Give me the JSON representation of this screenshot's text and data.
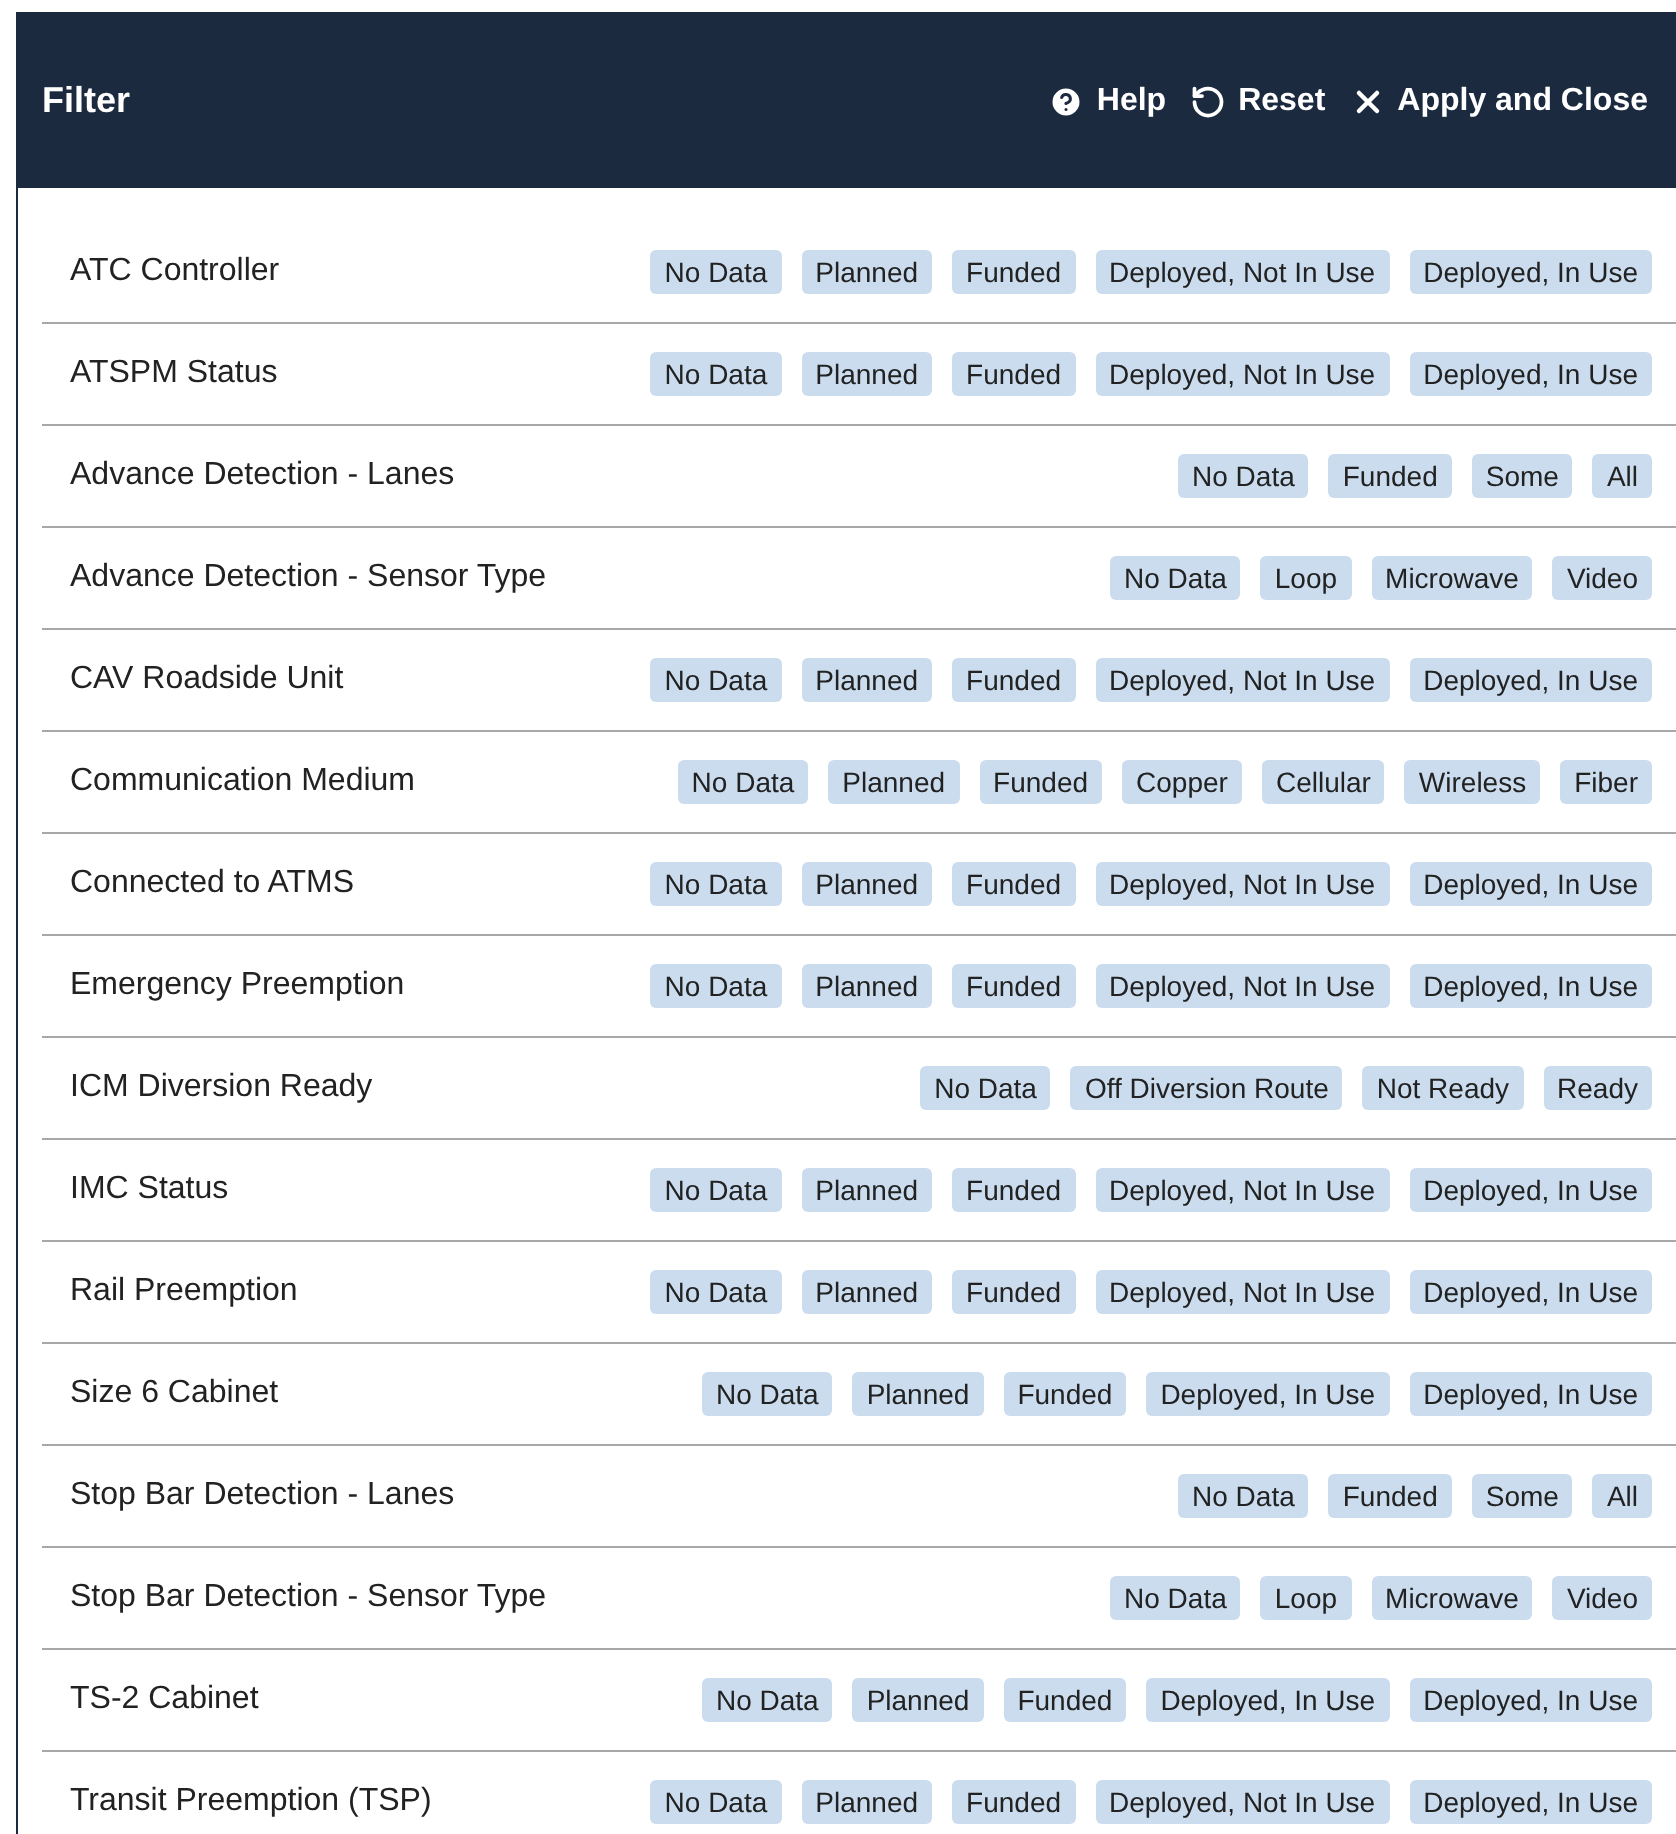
{
  "header": {
    "title": "Filter",
    "actions": [
      {
        "kind": "help",
        "label": "Help"
      },
      {
        "kind": "reset",
        "label": "Reset"
      },
      {
        "kind": "close",
        "label": "Apply and Close"
      }
    ]
  },
  "rows": [
    {
      "label": "ATC Controller",
      "options": [
        "No Data",
        "Planned",
        "Funded",
        "Deployed, Not In Use",
        "Deployed, In Use"
      ]
    },
    {
      "label": "ATSPM Status",
      "options": [
        "No Data",
        "Planned",
        "Funded",
        "Deployed, Not In Use",
        "Deployed, In Use"
      ]
    },
    {
      "label": "Advance Detection - Lanes",
      "options": [
        "No Data",
        "Funded",
        "Some",
        "All"
      ]
    },
    {
      "label": "Advance Detection - Sensor Type",
      "options": [
        "No Data",
        "Loop",
        "Microwave",
        "Video"
      ]
    },
    {
      "label": "CAV Roadside Unit",
      "options": [
        "No Data",
        "Planned",
        "Funded",
        "Deployed, Not In Use",
        "Deployed, In Use"
      ]
    },
    {
      "label": "Communication Medium",
      "options": [
        "No Data",
        "Planned",
        "Funded",
        "Copper",
        "Cellular",
        "Wireless",
        "Fiber"
      ]
    },
    {
      "label": "Connected to ATMS",
      "options": [
        "No Data",
        "Planned",
        "Funded",
        "Deployed, Not In Use",
        "Deployed, In Use"
      ]
    },
    {
      "label": "Emergency Preemption",
      "options": [
        "No Data",
        "Planned",
        "Funded",
        "Deployed, Not In Use",
        "Deployed, In Use"
      ]
    },
    {
      "label": "ICM Diversion Ready",
      "options": [
        "No Data",
        "Off Diversion Route",
        "Not Ready",
        "Ready"
      ]
    },
    {
      "label": "IMC Status",
      "options": [
        "No Data",
        "Planned",
        "Funded",
        "Deployed, Not In Use",
        "Deployed, In Use"
      ]
    },
    {
      "label": "Rail Preemption",
      "options": [
        "No Data",
        "Planned",
        "Funded",
        "Deployed, Not In Use",
        "Deployed, In Use"
      ]
    },
    {
      "label": "Size 6 Cabinet",
      "options": [
        "No Data",
        "Planned",
        "Funded",
        "Deployed, In Use",
        "Deployed, In Use"
      ]
    },
    {
      "label": "Stop Bar Detection - Lanes",
      "options": [
        "No Data",
        "Funded",
        "Some",
        "All"
      ]
    },
    {
      "label": "Stop Bar Detection - Sensor Type",
      "options": [
        "No Data",
        "Loop",
        "Microwave",
        "Video"
      ]
    },
    {
      "label": "TS-2 Cabinet",
      "options": [
        "No Data",
        "Planned",
        "Funded",
        "Deployed, In Use",
        "Deployed, In Use"
      ]
    },
    {
      "label": "Transit Preemption (TSP)",
      "options": [
        "No Data",
        "Planned",
        "Funded",
        "Deployed, Not In Use",
        "Deployed, In Use"
      ]
    }
  ]
}
